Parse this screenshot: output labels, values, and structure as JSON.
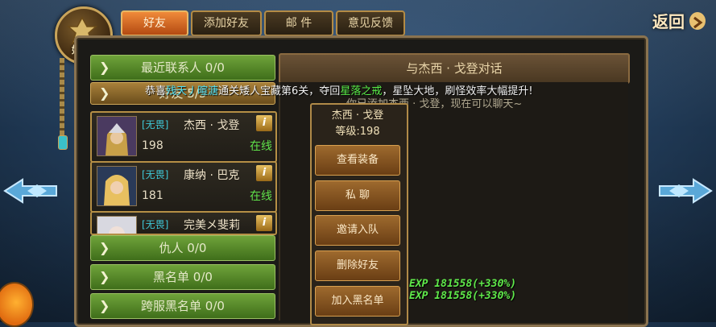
{
  "header": {
    "section_label": "好友",
    "back_label": "返回",
    "tabs": [
      {
        "label": "好友",
        "active": true
      },
      {
        "label": "添加好友",
        "active": false
      },
      {
        "label": "邮 件",
        "active": false
      },
      {
        "label": "意见反馈",
        "active": false
      }
    ]
  },
  "sidebar": {
    "categories": {
      "recent": "最近联系人 0/0",
      "friends": "好友 5/5",
      "enemies": "仇人 0/0",
      "blacklist": "黑名单 0/0",
      "cross_blacklist": "跨服黑名单 0/0"
    },
    "friends": [
      {
        "title": "[无畏]",
        "name": "杰西 · 戈登",
        "level": "198",
        "status": "在线",
        "info": "i"
      },
      {
        "title": "[无畏]",
        "name": "康纳 · 巴克",
        "level": "181",
        "status": "在线",
        "info": "i"
      },
      {
        "title": "[无畏]",
        "name": "完美メ斐莉",
        "level": "",
        "status": "",
        "info": "i"
      }
    ]
  },
  "chat": {
    "title": "与杰西 · 戈登对话",
    "behind_text": "你已添加杰西 · 戈登，现在可以聊天~"
  },
  "broadcast": {
    "prefix": "恭喜",
    "player": "残天丿暄溏",
    "mid": "通关矮人宝藏第6关，夺回",
    "item": "星落之戒",
    "suffix": "，星坠大地，刷怪效率大幅提升!"
  },
  "popup": {
    "name": "杰西 · 戈登",
    "level": "等级:198",
    "buttons": [
      "查看装备",
      "私 聊",
      "邀请入队",
      "删除好友",
      "加入黑名单"
    ]
  },
  "exp_messages": [
    "EXP 181558(+330%)",
    "EXP 181558(+330%)"
  ],
  "colors": {
    "online": "#5fe04a",
    "title_cyan": "#3fc8d8",
    "category_green": "#6fa33a"
  }
}
